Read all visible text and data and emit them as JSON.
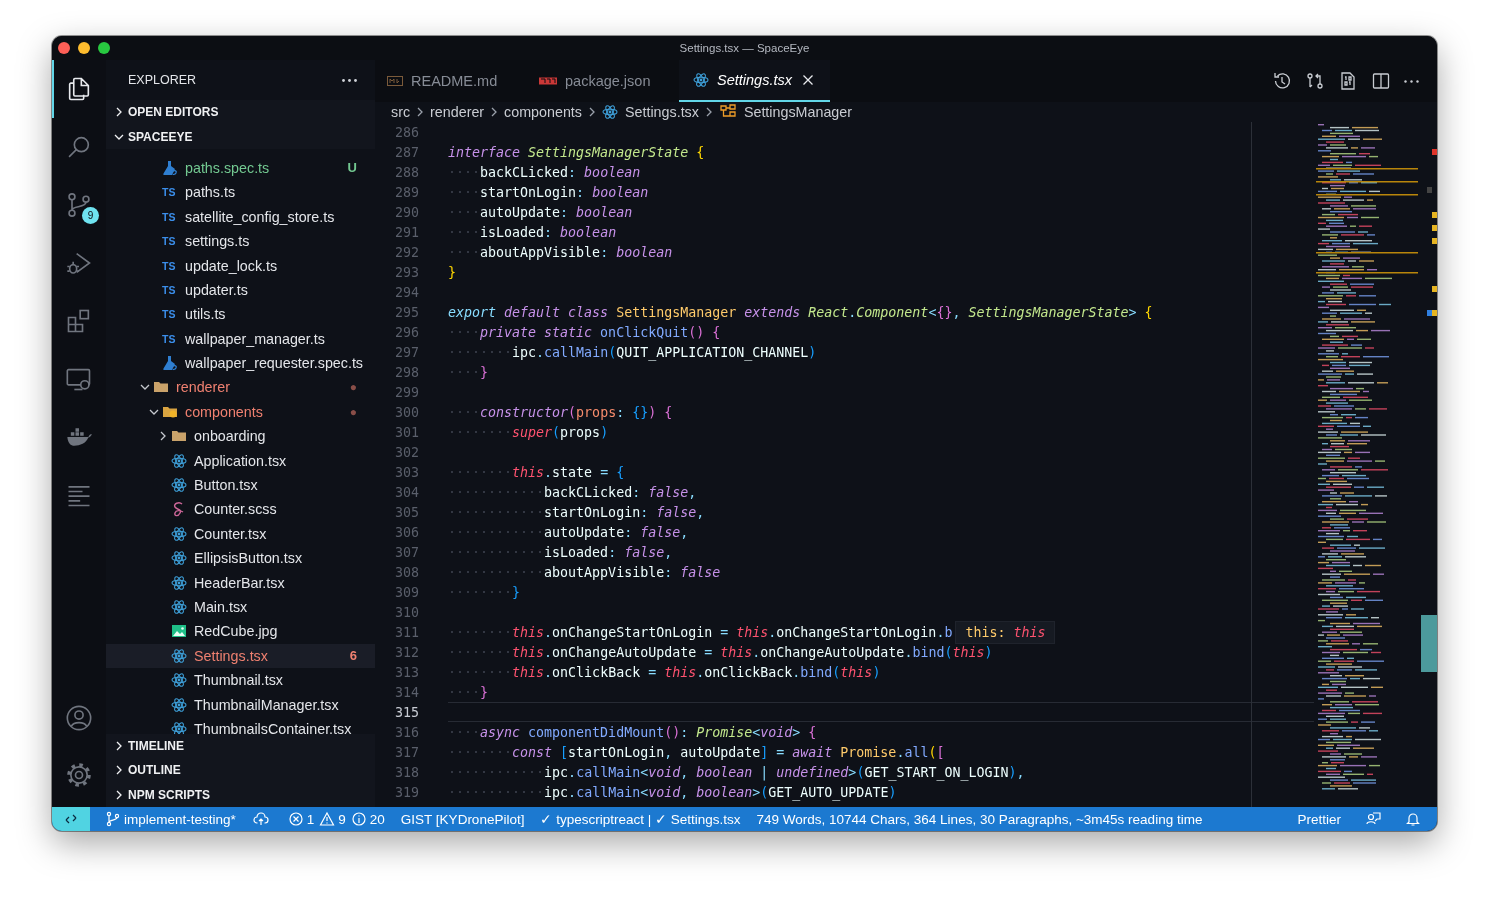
{
  "window": {
    "title": "Settings.tsx — SpaceEye"
  },
  "activity_bar": {
    "items": [
      {
        "kind": "explorer",
        "selected": true
      },
      {
        "kind": "search",
        "selected": false
      },
      {
        "kind": "source_control",
        "selected": false,
        "badge": "9"
      },
      {
        "kind": "run_debug",
        "selected": false
      },
      {
        "kind": "extensions",
        "selected": false
      },
      {
        "kind": "remote_explorer",
        "selected": false
      },
      {
        "kind": "docker",
        "selected": false
      },
      {
        "kind": "outline_list",
        "selected": false
      }
    ],
    "bottom_items": [
      {
        "kind": "account"
      },
      {
        "kind": "manage"
      }
    ]
  },
  "sidebar": {
    "title": "EXPLORER",
    "sections": [
      {
        "title": "OPEN EDITORS",
        "expanded": false
      },
      {
        "title": "SPACEEYE",
        "expanded": true,
        "scrolled_folder_children": [
          {
            "name": "paths.spec.ts",
            "kind": "test",
            "selected": false,
            "color": "#73c991",
            "badge": "U"
          },
          {
            "name": "paths.ts",
            "kind": "ts",
            "icon_label": "TS",
            "selected": false,
            "color": "#e4e6ea"
          },
          {
            "name": "satellite_config_store.ts",
            "kind": "ts",
            "icon_label": "TS",
            "selected": false,
            "color": "#e4e6ea"
          },
          {
            "name": "settings.ts",
            "kind": "ts",
            "icon_label": "TS",
            "selected": false,
            "color": "#e4e6ea"
          },
          {
            "name": "update_lock.ts",
            "kind": "ts",
            "icon_label": "TS",
            "selected": false,
            "color": "#e4e6ea"
          },
          {
            "name": "updater.ts",
            "kind": "ts",
            "icon_label": "TS",
            "selected": false,
            "color": "#e4e6ea"
          },
          {
            "name": "utils.ts",
            "kind": "ts",
            "icon_label": "TS",
            "selected": false,
            "color": "#e4e6ea"
          },
          {
            "name": "wallpaper_manager.ts",
            "kind": "ts",
            "icon_label": "TS",
            "selected": false,
            "color": "#e4e6ea"
          },
          {
            "name": "wallpaper_requester.spec.ts",
            "kind": "test",
            "selected": false,
            "color": "#e4e6ea"
          }
        ],
        "items": [
          {
            "name": "renderer",
            "kind": "folder",
            "expanded": true,
            "selected": false,
            "color": "#ef8070",
            "badge": "●",
            "children": [
              {
                "name": "components",
                "kind": "components_folder",
                "expanded": true,
                "selected": false,
                "color": "#ef8070",
                "badge": "●",
                "children": [
                  {
                    "name": "onboarding",
                    "kind": "folder",
                    "expanded": false,
                    "selected": false,
                    "color": "#e4e6ea"
                  },
                  {
                    "name": "Application.tsx",
                    "kind": "react",
                    "selected": false,
                    "color": "#e4e6ea"
                  },
                  {
                    "name": "Button.tsx",
                    "kind": "react",
                    "selected": false,
                    "color": "#e4e6ea"
                  },
                  {
                    "name": "Counter.scss",
                    "kind": "scss",
                    "selected": false,
                    "color": "#e4e6ea"
                  },
                  {
                    "name": "Counter.tsx",
                    "kind": "react",
                    "selected": false,
                    "color": "#e4e6ea"
                  },
                  {
                    "name": "EllipsisButton.tsx",
                    "kind": "react",
                    "selected": false,
                    "color": "#e4e6ea"
                  },
                  {
                    "name": "HeaderBar.tsx",
                    "kind": "react",
                    "selected": false,
                    "color": "#e4e6ea"
                  },
                  {
                    "name": "Main.tsx",
                    "kind": "react",
                    "selected": false,
                    "color": "#e4e6ea"
                  },
                  {
                    "name": "RedCube.jpg",
                    "kind": "image",
                    "selected": false,
                    "color": "#e4e6ea"
                  },
                  {
                    "name": "Settings.tsx",
                    "kind": "react",
                    "selected": true,
                    "color": "#ef8070",
                    "badge": "6"
                  },
                  {
                    "name": "Thumbnail.tsx",
                    "kind": "react",
                    "selected": false,
                    "color": "#e4e6ea"
                  },
                  {
                    "name": "ThumbnailManager.tsx",
                    "kind": "react",
                    "selected": false,
                    "color": "#e4e6ea"
                  },
                  {
                    "name": "ThumbnailsContainer.tsx",
                    "kind": "react",
                    "selected": false,
                    "color": "#e4e6ea"
                  }
                ]
              }
            ]
          }
        ]
      },
      {
        "title": "TIMELINE",
        "expanded": false
      },
      {
        "title": "OUTLINE",
        "expanded": false
      },
      {
        "title": "NPM SCRIPTS",
        "expanded": false
      }
    ]
  },
  "editor": {
    "tabs": [
      {
        "label": "README.md",
        "kind": "markdown",
        "selected": false
      },
      {
        "label": "package.json",
        "kind": "npm",
        "selected": false
      },
      {
        "label": "Settings.tsx",
        "kind": "react",
        "selected": true
      }
    ],
    "actions": [
      {
        "kind": "history"
      },
      {
        "kind": "compare"
      },
      {
        "kind": "binary"
      },
      {
        "kind": "split"
      },
      {
        "kind": "more"
      }
    ],
    "breadcrumb": [
      {
        "label": "src",
        "kind": "folder"
      },
      {
        "label": "renderer",
        "kind": "folder"
      },
      {
        "label": "components",
        "kind": "folder"
      },
      {
        "label": "Settings.tsx",
        "kind": "react"
      },
      {
        "label": "SettingsManager",
        "kind": "class"
      }
    ],
    "lines": [
      {
        "number": "286",
        "current": false
      },
      {
        "number": "287",
        "current": false,
        "tokens": [
          {
            "kind": "kw",
            "text": "interface"
          },
          {
            "kind": "type",
            "text": " SettingsManagerState"
          },
          {
            "kind": "b1",
            "text": " {"
          }
        ]
      },
      {
        "number": "288",
        "current": false,
        "tokens": [
          {
            "kind": "ws",
            "text": "····"
          },
          {
            "kind": "prop",
            "text": "backCLicked"
          },
          {
            "kind": "punct",
            "text": ":"
          },
          {
            "kind": "kw",
            "text": " boolean"
          }
        ]
      },
      {
        "number": "289",
        "current": false,
        "tokens": [
          {
            "kind": "ws",
            "text": "····"
          },
          {
            "kind": "prop",
            "text": "startOnLogin"
          },
          {
            "kind": "punct",
            "text": ":"
          },
          {
            "kind": "kw",
            "text": " boolean"
          }
        ]
      },
      {
        "number": "290",
        "current": false,
        "tokens": [
          {
            "kind": "ws",
            "text": "····"
          },
          {
            "kind": "prop",
            "text": "autoUpdate"
          },
          {
            "kind": "punct",
            "text": ":"
          },
          {
            "kind": "kw",
            "text": " boolean"
          }
        ]
      },
      {
        "number": "291",
        "current": false,
        "tokens": [
          {
            "kind": "ws",
            "text": "····"
          },
          {
            "kind": "prop",
            "text": "isLoaded"
          },
          {
            "kind": "punct",
            "text": ":"
          },
          {
            "kind": "kw",
            "text": " boolean"
          }
        ]
      },
      {
        "number": "292",
        "current": false,
        "tokens": [
          {
            "kind": "ws",
            "text": "····"
          },
          {
            "kind": "prop",
            "text": "aboutAppVisible"
          },
          {
            "kind": "punct",
            "text": ":"
          },
          {
            "kind": "kw",
            "text": " boolean"
          }
        ]
      },
      {
        "number": "293",
        "current": false,
        "tokens": [
          {
            "kind": "b1",
            "text": "}"
          }
        ]
      },
      {
        "number": "294",
        "current": false
      },
      {
        "number": "295",
        "current": false,
        "tokens": [
          {
            "kind": "kw2",
            "text": "export"
          },
          {
            "kind": "kw",
            "text": " default class"
          },
          {
            "kind": "cls",
            "text": " SettingsManager"
          },
          {
            "kind": "kw",
            "text": " extends"
          },
          {
            "kind": "type",
            "text": " React"
          },
          {
            "kind": "punct",
            "text": "."
          },
          {
            "kind": "type",
            "text": "Component"
          },
          {
            "kind": "punct",
            "text": "<"
          },
          {
            "kind": "b2",
            "text": "{}"
          },
          {
            "kind": "punct",
            "text": ", "
          },
          {
            "kind": "type",
            "text": "SettingsManagerState"
          },
          {
            "kind": "punct",
            "text": ">"
          },
          {
            "kind": "b1",
            "text": " {"
          }
        ]
      },
      {
        "number": "296",
        "current": false,
        "tokens": [
          {
            "kind": "ws",
            "text": "····"
          },
          {
            "kind": "kw",
            "text": "private static"
          },
          {
            "kind": "fn",
            "text": " onClickQuit"
          },
          {
            "kind": "b2",
            "text": "()"
          },
          {
            "kind": "b2",
            "text": " {"
          }
        ]
      },
      {
        "number": "297",
        "current": false,
        "tokens": [
          {
            "kind": "ws",
            "text": "········"
          },
          {
            "kind": "plain",
            "text": "ipc"
          },
          {
            "kind": "punct",
            "text": "."
          },
          {
            "kind": "fn",
            "text": "callMain"
          },
          {
            "kind": "b3",
            "text": "("
          },
          {
            "kind": "plain",
            "text": "QUIT_APPLICATION_CHANNEL"
          },
          {
            "kind": "b3",
            "text": ")"
          }
        ]
      },
      {
        "number": "298",
        "current": false,
        "tokens": [
          {
            "kind": "ws",
            "text": "····"
          },
          {
            "kind": "b2",
            "text": "}"
          }
        ]
      },
      {
        "number": "299",
        "current": false
      },
      {
        "number": "300",
        "current": false,
        "tokens": [
          {
            "kind": "ws",
            "text": "····"
          },
          {
            "kind": "kw",
            "text": "constructor"
          },
          {
            "kind": "b2",
            "text": "("
          },
          {
            "kind": "param",
            "text": "props"
          },
          {
            "kind": "punct",
            "text": ":"
          },
          {
            "kind": "b3",
            "text": " {}"
          },
          {
            "kind": "b2",
            "text": ")"
          },
          {
            "kind": "b2",
            "text": " {"
          }
        ]
      },
      {
        "number": "301",
        "current": false,
        "tokens": [
          {
            "kind": "ws",
            "text": "········"
          },
          {
            "kind": "this",
            "text": "super"
          },
          {
            "kind": "b3",
            "text": "("
          },
          {
            "kind": "plain",
            "text": "props"
          },
          {
            "kind": "b3",
            "text": ")"
          }
        ]
      },
      {
        "number": "302",
        "current": false
      },
      {
        "number": "303",
        "current": false,
        "tokens": [
          {
            "kind": "ws",
            "text": "········"
          },
          {
            "kind": "this",
            "text": "this"
          },
          {
            "kind": "punct",
            "text": "."
          },
          {
            "kind": "plain",
            "text": "state"
          },
          {
            "kind": "punct",
            "text": " ="
          },
          {
            "kind": "b3",
            "text": " {"
          }
        ]
      },
      {
        "number": "304",
        "current": false,
        "tokens": [
          {
            "kind": "ws",
            "text": "············"
          },
          {
            "kind": "prop",
            "text": "backCLicked"
          },
          {
            "kind": "punct",
            "text": ":"
          },
          {
            "kind": "kw",
            "text": " false"
          },
          {
            "kind": "punct",
            "text": ","
          }
        ]
      },
      {
        "number": "305",
        "current": false,
        "tokens": [
          {
            "kind": "ws",
            "text": "············"
          },
          {
            "kind": "prop",
            "text": "startOnLogin"
          },
          {
            "kind": "punct",
            "text": ":"
          },
          {
            "kind": "kw",
            "text": " false"
          },
          {
            "kind": "punct",
            "text": ","
          }
        ]
      },
      {
        "number": "306",
        "current": false,
        "tokens": [
          {
            "kind": "ws",
            "text": "············"
          },
          {
            "kind": "prop",
            "text": "autoUpdate"
          },
          {
            "kind": "punct",
            "text": ":"
          },
          {
            "kind": "kw",
            "text": " false"
          },
          {
            "kind": "punct",
            "text": ","
          }
        ]
      },
      {
        "number": "307",
        "current": false,
        "tokens": [
          {
            "kind": "ws",
            "text": "············"
          },
          {
            "kind": "prop",
            "text": "isLoaded"
          },
          {
            "kind": "punct",
            "text": ":"
          },
          {
            "kind": "kw",
            "text": " false"
          },
          {
            "kind": "punct",
            "text": ","
          }
        ]
      },
      {
        "number": "308",
        "current": false,
        "tokens": [
          {
            "kind": "ws",
            "text": "············"
          },
          {
            "kind": "prop",
            "text": "aboutAppVisible"
          },
          {
            "kind": "punct",
            "text": ":"
          },
          {
            "kind": "kw",
            "text": " false"
          }
        ]
      },
      {
        "number": "309",
        "current": false,
        "tokens": [
          {
            "kind": "ws",
            "text": "········"
          },
          {
            "kind": "b3",
            "text": "}"
          }
        ]
      },
      {
        "number": "310",
        "current": false
      },
      {
        "number": "311",
        "current": false,
        "tokens": [
          {
            "kind": "ws",
            "text": "········"
          },
          {
            "kind": "this",
            "text": "this"
          },
          {
            "kind": "punct",
            "text": "."
          },
          {
            "kind": "plain",
            "text": "onChangeStartOnLogin"
          },
          {
            "kind": "punct",
            "text": " ="
          },
          {
            "kind": "this",
            "text": " this"
          },
          {
            "kind": "punct",
            "text": "."
          },
          {
            "kind": "plain",
            "text": "onChangeStartOnLogin"
          },
          {
            "kind": "punct",
            "text": "."
          },
          {
            "kind": "fn",
            "text": "b"
          }
        ],
        "hover": {
          "label": "this:",
          "value": "this"
        }
      },
      {
        "number": "312",
        "current": false,
        "tokens": [
          {
            "kind": "ws",
            "text": "········"
          },
          {
            "kind": "this",
            "text": "this"
          },
          {
            "kind": "punct",
            "text": "."
          },
          {
            "kind": "plain",
            "text": "onChangeAutoUpdate"
          },
          {
            "kind": "punct",
            "text": " ="
          },
          {
            "kind": "this",
            "text": " this"
          },
          {
            "kind": "punct",
            "text": "."
          },
          {
            "kind": "plain",
            "text": "onChangeAutoUpdate"
          },
          {
            "kind": "punct",
            "text": "."
          },
          {
            "kind": "fn",
            "text": "bind"
          },
          {
            "kind": "b3",
            "text": "("
          },
          {
            "kind": "this",
            "text": "this"
          },
          {
            "kind": "b3",
            "text": ")"
          }
        ]
      },
      {
        "number": "313",
        "current": false,
        "tokens": [
          {
            "kind": "ws",
            "text": "········"
          },
          {
            "kind": "this",
            "text": "this"
          },
          {
            "kind": "punct",
            "text": "."
          },
          {
            "kind": "plain",
            "text": "onClickBack"
          },
          {
            "kind": "punct",
            "text": " ="
          },
          {
            "kind": "this",
            "text": " this"
          },
          {
            "kind": "punct",
            "text": "."
          },
          {
            "kind": "plain",
            "text": "onClickBack"
          },
          {
            "kind": "punct",
            "text": "."
          },
          {
            "kind": "fn",
            "text": "bind"
          },
          {
            "kind": "b3",
            "text": "("
          },
          {
            "kind": "this",
            "text": "this"
          },
          {
            "kind": "b3",
            "text": ")"
          }
        ]
      },
      {
        "number": "314",
        "current": false,
        "tokens": [
          {
            "kind": "ws",
            "text": "····"
          },
          {
            "kind": "b2",
            "text": "}"
          }
        ]
      },
      {
        "number": "315",
        "current": true
      },
      {
        "number": "316",
        "current": false,
        "tokens": [
          {
            "kind": "ws",
            "text": "····"
          },
          {
            "kind": "kw",
            "text": "async"
          },
          {
            "kind": "fn",
            "text": " componentDidMount"
          },
          {
            "kind": "b2",
            "text": "()"
          },
          {
            "kind": "punct",
            "text": ":"
          },
          {
            "kind": "type",
            "text": " Promise"
          },
          {
            "kind": "punct",
            "text": "<"
          },
          {
            "kind": "kw",
            "text": "void"
          },
          {
            "kind": "punct",
            "text": ">"
          },
          {
            "kind": "b2",
            "text": " {"
          }
        ]
      },
      {
        "number": "317",
        "current": false,
        "tokens": [
          {
            "kind": "ws",
            "text": "········"
          },
          {
            "kind": "kw",
            "text": "const"
          },
          {
            "kind": "b3",
            "text": " ["
          },
          {
            "kind": "plain",
            "text": "startOnLogin"
          },
          {
            "kind": "punct",
            "text": ","
          },
          {
            "kind": "plain",
            "text": " autoUpdate"
          },
          {
            "kind": "b3",
            "text": "]"
          },
          {
            "kind": "punct",
            "text": " ="
          },
          {
            "kind": "kw",
            "text": " await"
          },
          {
            "kind": "cls",
            "text": " Promise"
          },
          {
            "kind": "punct",
            "text": "."
          },
          {
            "kind": "fn",
            "text": "all"
          },
          {
            "kind": "b1",
            "text": "("
          },
          {
            "kind": "b2",
            "text": "["
          }
        ]
      },
      {
        "number": "318",
        "current": false,
        "tokens": [
          {
            "kind": "ws",
            "text": "············"
          },
          {
            "kind": "plain",
            "text": "ipc"
          },
          {
            "kind": "punct",
            "text": "."
          },
          {
            "kind": "fn",
            "text": "callMain"
          },
          {
            "kind": "punct",
            "text": "<"
          },
          {
            "kind": "kw",
            "text": "void"
          },
          {
            "kind": "punct",
            "text": ","
          },
          {
            "kind": "kw",
            "text": " boolean"
          },
          {
            "kind": "punct",
            "text": " |"
          },
          {
            "kind": "kw",
            "text": " undefined"
          },
          {
            "kind": "punct",
            "text": ">"
          },
          {
            "kind": "b3",
            "text": "("
          },
          {
            "kind": "plain",
            "text": "GET_START_ON_LOGIN"
          },
          {
            "kind": "b3",
            "text": ")"
          },
          {
            "kind": "punct",
            "text": ","
          }
        ]
      },
      {
        "number": "319",
        "current": false,
        "tokens": [
          {
            "kind": "ws",
            "text": "············"
          },
          {
            "kind": "plain",
            "text": "ipc"
          },
          {
            "kind": "punct",
            "text": "."
          },
          {
            "kind": "fn",
            "text": "callMain"
          },
          {
            "kind": "punct",
            "text": "<"
          },
          {
            "kind": "kw",
            "text": "void"
          },
          {
            "kind": "punct",
            "text": ","
          },
          {
            "kind": "kw",
            "text": " boolean"
          },
          {
            "kind": "punct",
            "text": ">"
          },
          {
            "kind": "b3",
            "text": "("
          },
          {
            "kind": "plain",
            "text": "GET_AUTO_UPDATE"
          },
          {
            "kind": "b3",
            "text": ")"
          }
        ]
      }
    ]
  },
  "status_bar": {
    "left": [
      {
        "kind": "remote"
      },
      {
        "kind": "branch",
        "text": "implement-testing*"
      },
      {
        "kind": "sync"
      },
      {
        "kind": "problems",
        "errors": "1",
        "warnings": "9",
        "infos": "20"
      },
      {
        "kind": "text",
        "text": "GIST [KYDronePilot]"
      },
      {
        "kind": "text",
        "text": "✓ typescriptreact | ✓ Settings.tsx"
      },
      {
        "kind": "text",
        "text": "749 Words, 10744 Chars, 364 Lines, 30 Paragraphs, ~3m45s reading time"
      }
    ],
    "right": [
      {
        "kind": "text",
        "text": "Prettier"
      },
      {
        "kind": "feedback"
      },
      {
        "kind": "bell"
      }
    ]
  }
}
